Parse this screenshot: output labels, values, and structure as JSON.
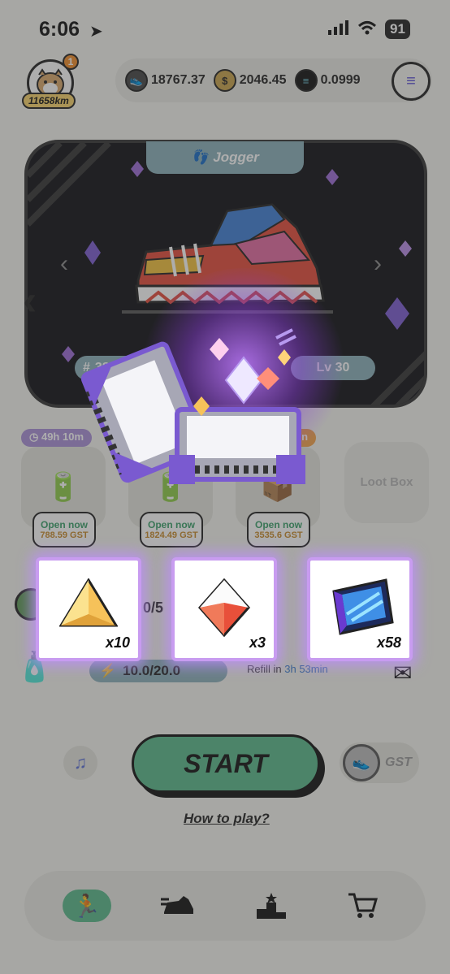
{
  "status_bar": {
    "time": "6:06",
    "battery": "91"
  },
  "profile": {
    "distance": "11658km",
    "notification_count": "1"
  },
  "balances": [
    {
      "name": "GMT",
      "value": "18767.37",
      "icon": "gmt-shoe-coin-icon",
      "color": "#444444"
    },
    {
      "name": "GST",
      "value": "2046.45",
      "icon": "gst-coin-icon",
      "color": "#c9a24a"
    },
    {
      "name": "SOL",
      "value": "0.0999",
      "icon": "solana-coin-icon",
      "color": "#111111"
    }
  ],
  "sneaker": {
    "type": "Jogger",
    "id": "383",
    "level": "Lv 30"
  },
  "mystery_boxes": {
    "timer_left": "49h 10m",
    "timer_right": "min",
    "slots": [
      {
        "open_label": "Open now",
        "cost": "788.59 GST"
      },
      {
        "open_label": "Open now",
        "cost": "1824.49 GST"
      },
      {
        "open_label": "Open now",
        "cost": "3535.6 GST"
      }
    ],
    "loot_box_label": "Loot Box"
  },
  "durability": {
    "counter": "0/5"
  },
  "energy": {
    "value": "10.0/20.0",
    "refill_prefix": "Refill in",
    "refill_time": "3h 53min"
  },
  "actions": {
    "start_label": "START",
    "gst_toggle": "GST",
    "how_to_play": "How to play?"
  },
  "nav": [
    {
      "name": "run-icon",
      "active": true
    },
    {
      "name": "sneaker-icon",
      "active": false
    },
    {
      "name": "podium-icon",
      "active": false
    },
    {
      "name": "cart-icon",
      "active": false
    }
  ],
  "rewards": [
    {
      "item": "yellow-gem-icon",
      "quantity": "x10"
    },
    {
      "item": "red-gem-icon",
      "quantity": "x3"
    },
    {
      "item": "scroll-icon",
      "quantity": "x58"
    }
  ],
  "colors": {
    "accent_green": "#58b98a",
    "glow_purple": "#c89cf0",
    "card_bg": "#0e0e14"
  }
}
